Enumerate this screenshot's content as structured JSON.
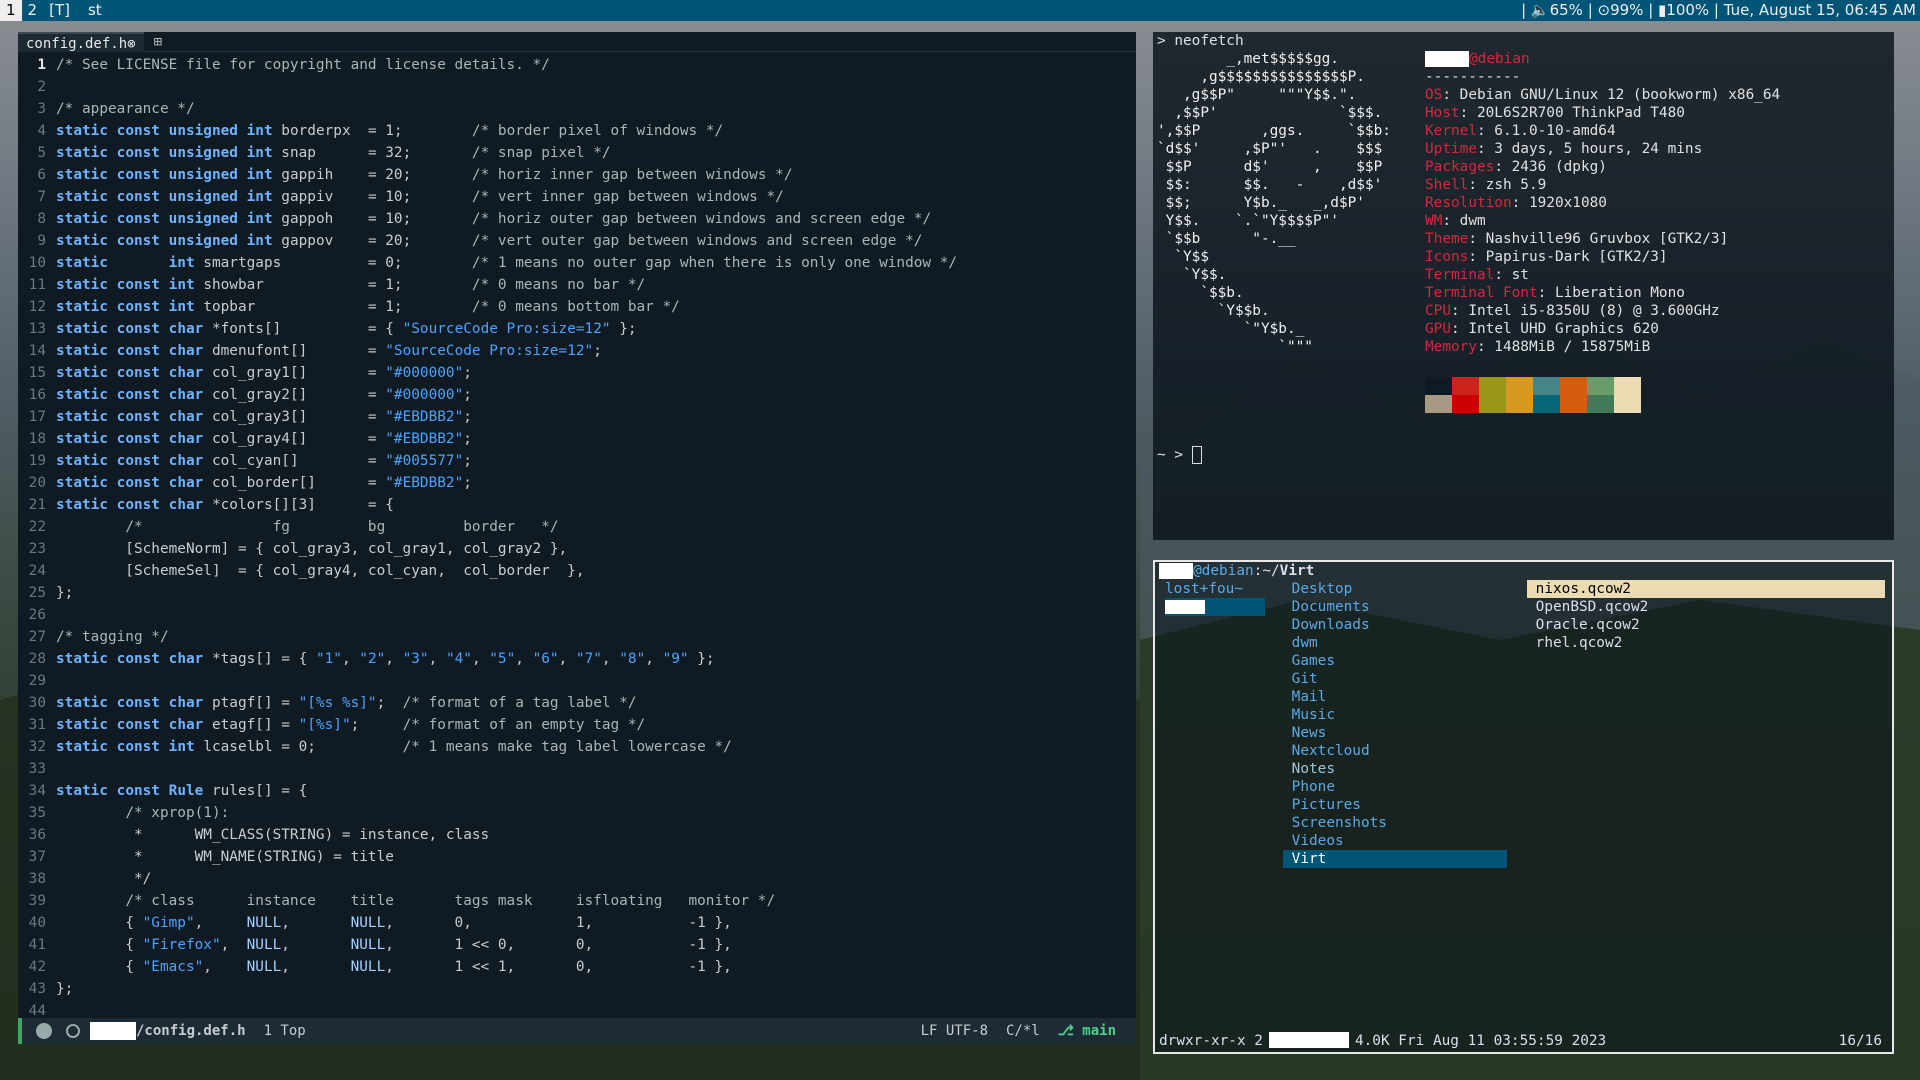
{
  "bar": {
    "tags": [
      "1",
      "2",
      "[T]",
      "st"
    ],
    "status": "| 🔈65% | ⊙99% | ▮100% | Tue, August 15, 06:45 AM"
  },
  "editor": {
    "tab_label": "config.def.h",
    "tab_close": "⊗",
    "lines": [
      "/* See LICENSE file for copyright and license details. */",
      "",
      "/* appearance */",
      "static const unsigned int borderpx  = 1;        /* border pixel of windows */",
      "static const unsigned int snap      = 32;       /* snap pixel */",
      "static const unsigned int gappih    = 20;       /* horiz inner gap between windows */",
      "static const unsigned int gappiv    = 10;       /* vert inner gap between windows */",
      "static const unsigned int gappoh    = 10;       /* horiz outer gap between windows and screen edge */",
      "static const unsigned int gappov    = 20;       /* vert outer gap between windows and screen edge */",
      "static       int smartgaps          = 0;        /* 1 means no outer gap when there is only one window */",
      "static const int showbar            = 1;        /* 0 means no bar */",
      "static const int topbar             = 1;        /* 0 means bottom bar */",
      "static const char *fonts[]          = { \"SourceCode Pro:size=12\" };",
      "static const char dmenufont[]       = \"SourceCode Pro:size=12\";",
      "static const char col_gray1[]       = \"#000000\";",
      "static const char col_gray2[]       = \"#000000\";",
      "static const char col_gray3[]       = \"#EBDBB2\";",
      "static const char col_gray4[]       = \"#EBDBB2\";",
      "static const char col_cyan[]        = \"#005577\";",
      "static const char col_border[]      = \"#EBDBB2\";",
      "static const char *colors[][3]      = {",
      "        /*               fg         bg         border   */",
      "        [SchemeNorm] = { col_gray3, col_gray1, col_gray2 },",
      "        [SchemeSel]  = { col_gray4, col_cyan,  col_border  },",
      "};",
      "",
      "/* tagging */",
      "static const char *tags[] = { \"1\", \"2\", \"3\", \"4\", \"5\", \"6\", \"7\", \"8\", \"9\" };",
      "",
      "static const char ptagf[] = \"[%s %s]\";  /* format of a tag label */",
      "static const char etagf[] = \"[%s]\";     /* format of an empty tag */",
      "static const int lcaselbl = 0;          /* 1 means make tag label lowercase */",
      "",
      "static const Rule rules[] = {",
      "        /* xprop(1):",
      "         *      WM_CLASS(STRING) = instance, class",
      "         *      WM_NAME(STRING) = title",
      "         */",
      "        /* class      instance    title       tags mask     isfloating   monitor */",
      "        { \"Gimp\",     NULL,       NULL,       0,            1,           -1 },",
      "        { \"Firefox\",  NULL,       NULL,       1 << 0,       0,           -1 },",
      "        { \"Emacs\",    NULL,       NULL,       1 << 1,       0,           -1 },",
      "};",
      ""
    ],
    "modeline": {
      "path": "/config.def.h",
      "position": "1 Top",
      "encoding": "LF UTF-8",
      "mode": "C/*l",
      "branch": "main"
    }
  },
  "neofetch": {
    "command": "> neofetch",
    "host_suffix": "@debian",
    "separator": "-----------",
    "logo": [
      "        _,met$$$$$gg.",
      "     ,g$$$$$$$$$$$$$$$P.",
      "   ,g$$P\"     \"\"\"Y$$.\".",
      "  ,$$P'              `$$$.",
      "',$$P       ,ggs.     `$$b:",
      "`d$$'     ,$P\"'   .    $$$",
      " $$P      d$'     ,    $$P",
      " $$:      $$.   -    ,d$$'",
      " $$;      Y$b._   _,d$P'",
      " Y$$.    `.`\"Y$$$$P\"'",
      " `$$b      \"-.__",
      "  `Y$$",
      "   `Y$$.",
      "     `$$b.",
      "       `Y$$b.",
      "          `\"Y$b._",
      "              `\"\"\""
    ],
    "info": [
      {
        "k": "OS",
        "v": "Debian GNU/Linux 12 (bookworm) x86_64"
      },
      {
        "k": "Host",
        "v": "20L6S2R700 ThinkPad T480"
      },
      {
        "k": "Kernel",
        "v": "6.1.0-10-amd64"
      },
      {
        "k": "Uptime",
        "v": "3 days, 5 hours, 24 mins"
      },
      {
        "k": "Packages",
        "v": "2436 (dpkg)"
      },
      {
        "k": "Shell",
        "v": "zsh 5.9"
      },
      {
        "k": "Resolution",
        "v": "1920x1080"
      },
      {
        "k": "WM",
        "v": "dwm"
      },
      {
        "k": "Theme",
        "v": "Nashville96 Gruvbox [GTK2/3]"
      },
      {
        "k": "Icons",
        "v": "Papirus-Dark [GTK2/3]"
      },
      {
        "k": "Terminal",
        "v": "st"
      },
      {
        "k": "Terminal Font",
        "v": "Liberation Mono"
      },
      {
        "k": "CPU",
        "v": "Intel i5-8350U (8) @ 3.600GHz"
      },
      {
        "k": "GPU",
        "v": "Intel UHD Graphics 620"
      },
      {
        "k": "Memory",
        "v": "1488MiB / 15875MiB"
      }
    ],
    "palette_top": [
      "#0f1a22",
      "#cc241d",
      "#98971a",
      "#d79921",
      "#458588",
      "#d65d0e",
      "#689d6a",
      "#ebdbb2"
    ],
    "palette_bottom": [
      "#a89984",
      "#cc0000",
      "#98971a",
      "#d79921",
      "#076678",
      "#d65d0e",
      "#427b58",
      "#ebdbb2"
    ],
    "prompt": "~ > "
  },
  "lf": {
    "header_host": "@debian",
    "header_path": ":~/",
    "header_dir": "Virt",
    "parent": [
      "lost+fou~",
      ""
    ],
    "dirs": [
      "Desktop",
      "Documents",
      "Downloads",
      "dwm",
      "Games",
      "Git",
      "Mail",
      "Music",
      "News",
      "Nextcloud",
      "Notes",
      "Phone",
      "Pictures",
      "Screenshots",
      "Videos",
      "Virt"
    ],
    "files": [
      "nixos.qcow2",
      "OpenBSD.qcow2",
      "Oracle.qcow2",
      "rhel.qcow2"
    ],
    "status_perm": "drwxr-xr-x 2",
    "status_info": "4.0K Fri Aug 11 03:55:59 2023",
    "status_count": "16/16"
  }
}
